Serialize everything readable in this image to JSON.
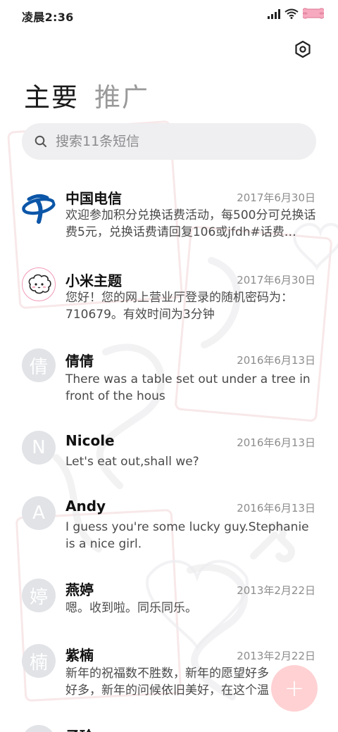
{
  "status_bar": {
    "time": "凌晨2:36"
  },
  "tabs": [
    {
      "label": "主要",
      "active": true
    },
    {
      "label": "推广",
      "active": false
    }
  ],
  "search": {
    "placeholder": "搜索11条短信"
  },
  "messages": [
    {
      "sender": "中国电信",
      "date": "2017年6月30日",
      "preview": "欢迎参加积分兑换话费活动，每500分可兑换话费5元，兑换话费请回复106或jfdh#话费…",
      "avatar": "china-telecom-logo"
    },
    {
      "sender": "小米主题",
      "date": "2017年6月30日",
      "preview": "您好！您的网上营业厅登录的随机密码为：710679。有效时间为3分钟",
      "avatar": "cartoon-sheep"
    },
    {
      "sender": "倩倩",
      "date": "2016年6月13日",
      "preview": "There was a table set out under a tree in front of the hous",
      "avatar_letter": "倩"
    },
    {
      "sender": "Nicole",
      "date": "2016年6月13日",
      "preview": "Let's eat out,shall we?",
      "avatar_letter": "N"
    },
    {
      "sender": "Andy",
      "date": "2016年6月13日",
      "preview": "I guess you're some lucky guy.Stephanie is a nice girl.",
      "avatar_letter": "A"
    },
    {
      "sender": "燕婷",
      "date": "2013年2月22日",
      "preview": "嗯。收到啦。同乐同乐。",
      "avatar_letter": "婷"
    },
    {
      "sender": "紫楠",
      "date": "2013年2月22日",
      "preview": "新年的祝福数不胜数，新年的愿望好多好多，新年的问候依旧美好，在这个温馨的时刻",
      "avatar_letter": "楠"
    },
    {
      "sender": "子玲",
      "date": "",
      "preview": "",
      "avatar_letter": "玲"
    }
  ],
  "fab": {
    "icon": "plus-icon",
    "label": "+"
  },
  "colors": {
    "avatar_bg": "#e1e3e7",
    "fab_bg": "#ffc2c4",
    "telecom_blue": "#0b56a8"
  }
}
